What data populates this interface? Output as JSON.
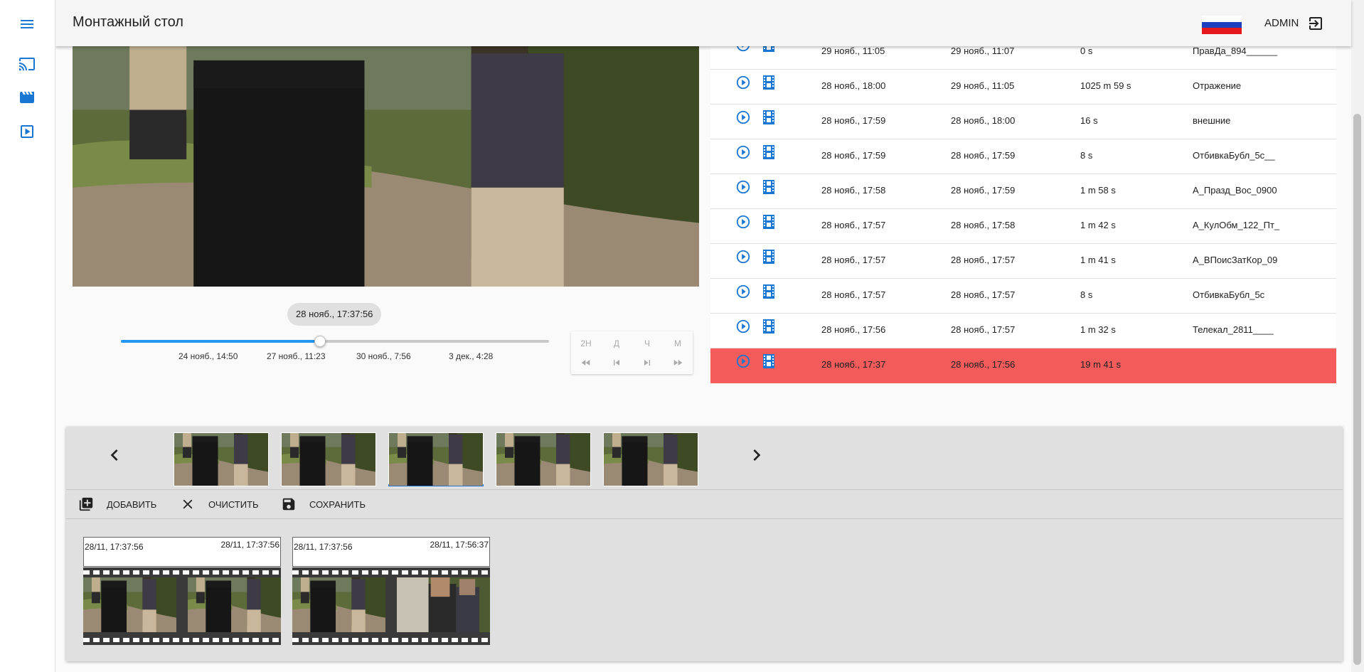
{
  "app": {
    "title": "Монтажный стол",
    "user": "ADMIN"
  },
  "colors": {
    "accent": "#1976d2",
    "slider": "#2196f3",
    "active_row": "#f45c5c",
    "flag": [
      "#ffffff",
      "#1c3fbf",
      "#e4181c"
    ]
  },
  "nav": {
    "menu_icon": "menu-icon",
    "items": [
      {
        "icon": "cast-icon"
      },
      {
        "icon": "movie-icon"
      },
      {
        "icon": "play-box-icon"
      }
    ]
  },
  "player": {
    "current_time": "28 нояб., 17:37:56",
    "position": 0.4645,
    "ticks": [
      "24 нояб., 14:50",
      "27 нояб., 11:23",
      "30 нояб., 7:56",
      "3 дек., 4:28"
    ],
    "scale_buttons": [
      "2Н",
      "Д",
      "Ч",
      "М"
    ],
    "transport_icons": [
      "fast-rewind-icon",
      "skip-previous-icon",
      "skip-next-icon",
      "fast-forward-icon"
    ]
  },
  "events": [
    {
      "start": "29 нояб., 11:05",
      "end": "29 нояб., 11:07",
      "duration": "0 s",
      "name": "ПравДа_894______"
    },
    {
      "start": "28 нояб., 18:00",
      "end": "29 нояб., 11:05",
      "duration": "1025 m 59 s",
      "name": "Отражение"
    },
    {
      "start": "28 нояб., 17:59",
      "end": "28 нояб., 18:00",
      "duration": "16 s",
      "name": "внешние"
    },
    {
      "start": "28 нояб., 17:59",
      "end": "28 нояб., 17:59",
      "duration": "8 s",
      "name": "ОтбивкаБубл_5с__"
    },
    {
      "start": "28 нояб., 17:58",
      "end": "28 нояб., 17:59",
      "duration": "1 m 58 s",
      "name": "А_Празд_Вос_0900"
    },
    {
      "start": "28 нояб., 17:57",
      "end": "28 нояб., 17:58",
      "duration": "1 m 42 s",
      "name": "А_КулОбм_122_Пт_"
    },
    {
      "start": "28 нояб., 17:57",
      "end": "28 нояб., 17:57",
      "duration": "1 m 41 s",
      "name": "А_ВПоисЗатКор_09"
    },
    {
      "start": "28 нояб., 17:57",
      "end": "28 нояб., 17:57",
      "duration": "8 s",
      "name": "ОтбивкаБубл_5с"
    },
    {
      "start": "28 нояб., 17:56",
      "end": "28 нояб., 17:57",
      "duration": "1 m 32 s",
      "name": "Телекал_2811____"
    },
    {
      "start": "28 нояб., 17:37",
      "end": "28 нояб., 17:56",
      "duration": "19 m 41 s",
      "name": "",
      "active": true
    }
  ],
  "editor": {
    "toolbar": {
      "add": "ДОБАВИТЬ",
      "clear": "ОЧИСТИТЬ",
      "save": "СОХРАНИТЬ"
    },
    "thumbnails_selected": 2,
    "clips": [
      {
        "start": "28/11, 17:37:56",
        "end": "28/11, 17:37:56"
      },
      {
        "start": "28/11, 17:37:56",
        "end": "28/11, 17:56:37"
      }
    ]
  }
}
